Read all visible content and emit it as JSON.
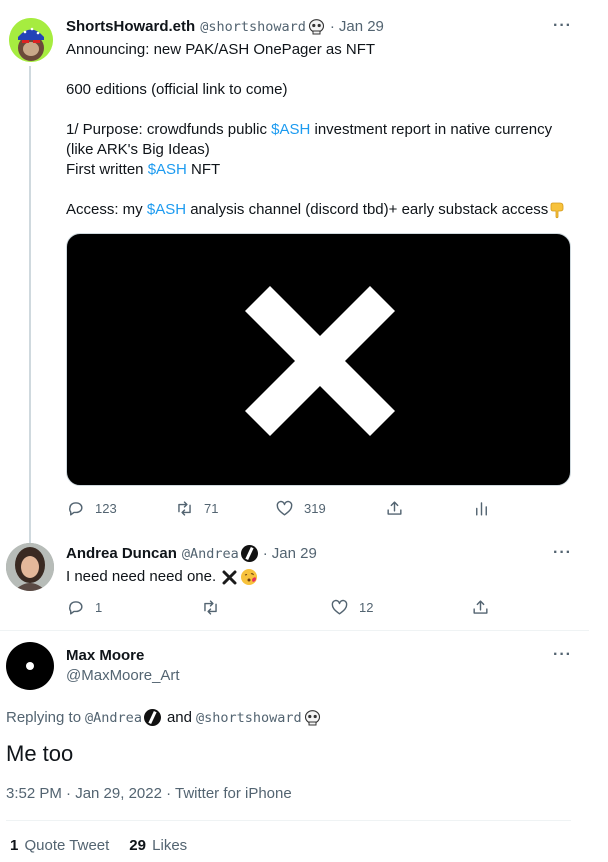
{
  "tweet1": {
    "name": "ShortsHoward.eth",
    "handle": "@shortshoward",
    "dot": "·",
    "time": "Jan 29",
    "more": "···",
    "lines": {
      "l1": "Announcing: new PAK/ASH OnePager as NFT",
      "l2": "600 editions (official link to come)",
      "l3a": "1/ Purpose: crowdfunds public ",
      "l3cash": "$ASH",
      "l3b": " investment report in native currency",
      "l4": "(like ARK's Big Ideas)",
      "l5a": "First written ",
      "l5cash": "$ASH",
      "l5b": " NFT",
      "l6a": "Access: my ",
      "l6cash": "$ASH",
      "l6b": " analysis channel (discord tbd)+ early substack access"
    },
    "actions": {
      "replies": "123",
      "retweets": "71",
      "likes": "319"
    }
  },
  "tweet2": {
    "name": "Andrea Duncan",
    "handle": "@Andrea",
    "dot": "·",
    "time": "Jan 29",
    "more": "···",
    "text": "I need need need one.",
    "actions": {
      "replies": "1",
      "retweets": "",
      "likes": "12"
    }
  },
  "main": {
    "name": "Max Moore",
    "handle": "@MaxMoore_Art",
    "more": "···",
    "replying_to": "Replying to",
    "reply_handle1": "@Andrea",
    "and": "and",
    "reply_handle2": "@shortshoward",
    "text": "Me too",
    "timestamp": "3:52 PM · Jan 29, 2022 · Twitter for iPhone",
    "stats": {
      "quote_count": "1",
      "quote_label": "Quote Tweet",
      "like_count": "29",
      "like_label": "Likes"
    }
  },
  "icons": [
    "reply-icon",
    "retweet-icon",
    "like-icon",
    "share-icon",
    "analytics-icon",
    "more-icon",
    "x-mark-emoji-icon",
    "kiss-emoji-icon",
    "point-down-emoji-icon",
    "skull-badge-icon",
    "nft-badge-icon"
  ],
  "colors": {
    "link": "#1d9bf0",
    "muted": "#536471",
    "text": "#0f1419",
    "thread": "#cfd9de"
  }
}
